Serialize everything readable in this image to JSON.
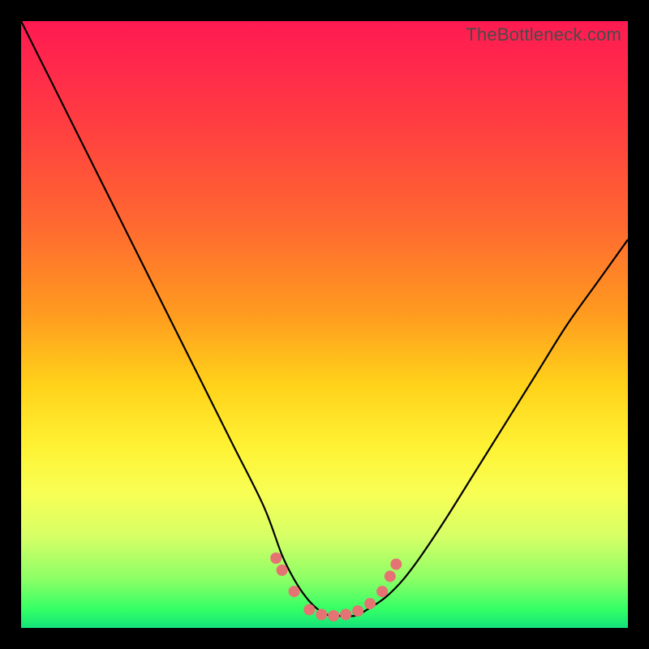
{
  "watermark": "TheBottleneck.com",
  "colors": {
    "frame": "#000000",
    "curve_stroke": "#000000",
    "marker_fill": "#e57373",
    "gradient_stops": [
      "#ff1a52",
      "#ff4040",
      "#ff9a1f",
      "#fff233",
      "#8cff66",
      "#14e37a"
    ]
  },
  "chart_data": {
    "type": "line",
    "title": "",
    "xlabel": "",
    "ylabel": "",
    "xlim": [
      0,
      100
    ],
    "ylim": [
      0,
      100
    ],
    "grid": false,
    "legend": false,
    "series": [
      {
        "name": "curve",
        "x": [
          0,
          5,
          10,
          15,
          20,
          25,
          30,
          35,
          40,
          43,
          45,
          47,
          49,
          51,
          53,
          55,
          57,
          60,
          63,
          66,
          70,
          75,
          80,
          85,
          90,
          95,
          100
        ],
        "y": [
          100,
          90,
          80,
          70,
          60,
          50,
          40,
          30,
          20,
          12,
          8,
          5,
          3,
          2,
          2,
          2,
          3,
          5,
          8,
          12,
          18,
          26,
          34,
          42,
          50,
          57,
          64
        ]
      }
    ],
    "markers": [
      {
        "x": 42.0,
        "y": 11.5
      },
      {
        "x": 43.0,
        "y": 9.5
      },
      {
        "x": 45.0,
        "y": 6.0
      },
      {
        "x": 47.5,
        "y": 3.0
      },
      {
        "x": 49.5,
        "y": 2.2
      },
      {
        "x": 51.5,
        "y": 2.0
      },
      {
        "x": 53.5,
        "y": 2.2
      },
      {
        "x": 55.5,
        "y": 2.8
      },
      {
        "x": 57.5,
        "y": 4.0
      },
      {
        "x": 59.5,
        "y": 6.0
      },
      {
        "x": 60.8,
        "y": 8.5
      },
      {
        "x": 61.8,
        "y": 10.5
      }
    ]
  }
}
